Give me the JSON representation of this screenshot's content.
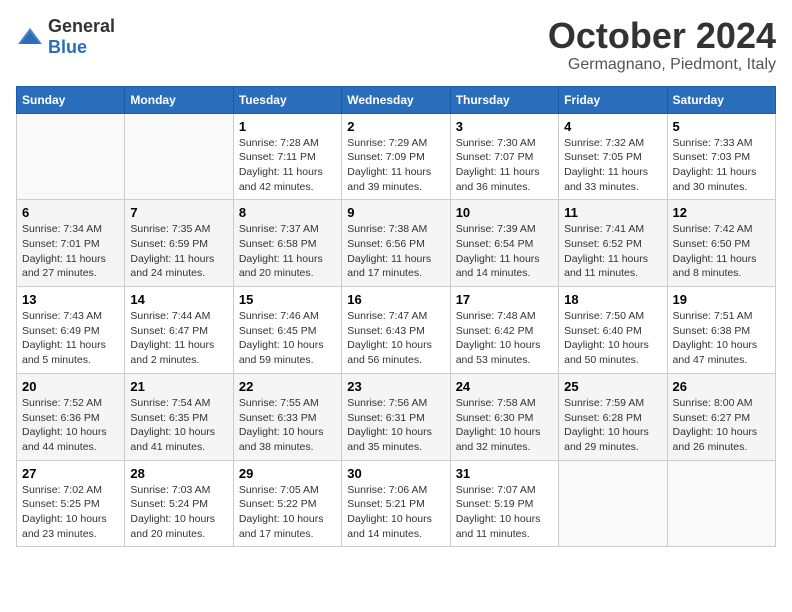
{
  "logo": {
    "general": "General",
    "blue": "Blue"
  },
  "title": "October 2024",
  "location": "Germagnano, Piedmont, Italy",
  "days_of_week": [
    "Sunday",
    "Monday",
    "Tuesday",
    "Wednesday",
    "Thursday",
    "Friday",
    "Saturday"
  ],
  "weeks": [
    [
      {
        "day": "",
        "info": ""
      },
      {
        "day": "",
        "info": ""
      },
      {
        "day": "1",
        "info": "Sunrise: 7:28 AM\nSunset: 7:11 PM\nDaylight: 11 hours and 42 minutes."
      },
      {
        "day": "2",
        "info": "Sunrise: 7:29 AM\nSunset: 7:09 PM\nDaylight: 11 hours and 39 minutes."
      },
      {
        "day": "3",
        "info": "Sunrise: 7:30 AM\nSunset: 7:07 PM\nDaylight: 11 hours and 36 minutes."
      },
      {
        "day": "4",
        "info": "Sunrise: 7:32 AM\nSunset: 7:05 PM\nDaylight: 11 hours and 33 minutes."
      },
      {
        "day": "5",
        "info": "Sunrise: 7:33 AM\nSunset: 7:03 PM\nDaylight: 11 hours and 30 minutes."
      }
    ],
    [
      {
        "day": "6",
        "info": "Sunrise: 7:34 AM\nSunset: 7:01 PM\nDaylight: 11 hours and 27 minutes."
      },
      {
        "day": "7",
        "info": "Sunrise: 7:35 AM\nSunset: 6:59 PM\nDaylight: 11 hours and 24 minutes."
      },
      {
        "day": "8",
        "info": "Sunrise: 7:37 AM\nSunset: 6:58 PM\nDaylight: 11 hours and 20 minutes."
      },
      {
        "day": "9",
        "info": "Sunrise: 7:38 AM\nSunset: 6:56 PM\nDaylight: 11 hours and 17 minutes."
      },
      {
        "day": "10",
        "info": "Sunrise: 7:39 AM\nSunset: 6:54 PM\nDaylight: 11 hours and 14 minutes."
      },
      {
        "day": "11",
        "info": "Sunrise: 7:41 AM\nSunset: 6:52 PM\nDaylight: 11 hours and 11 minutes."
      },
      {
        "day": "12",
        "info": "Sunrise: 7:42 AM\nSunset: 6:50 PM\nDaylight: 11 hours and 8 minutes."
      }
    ],
    [
      {
        "day": "13",
        "info": "Sunrise: 7:43 AM\nSunset: 6:49 PM\nDaylight: 11 hours and 5 minutes."
      },
      {
        "day": "14",
        "info": "Sunrise: 7:44 AM\nSunset: 6:47 PM\nDaylight: 11 hours and 2 minutes."
      },
      {
        "day": "15",
        "info": "Sunrise: 7:46 AM\nSunset: 6:45 PM\nDaylight: 10 hours and 59 minutes."
      },
      {
        "day": "16",
        "info": "Sunrise: 7:47 AM\nSunset: 6:43 PM\nDaylight: 10 hours and 56 minutes."
      },
      {
        "day": "17",
        "info": "Sunrise: 7:48 AM\nSunset: 6:42 PM\nDaylight: 10 hours and 53 minutes."
      },
      {
        "day": "18",
        "info": "Sunrise: 7:50 AM\nSunset: 6:40 PM\nDaylight: 10 hours and 50 minutes."
      },
      {
        "day": "19",
        "info": "Sunrise: 7:51 AM\nSunset: 6:38 PM\nDaylight: 10 hours and 47 minutes."
      }
    ],
    [
      {
        "day": "20",
        "info": "Sunrise: 7:52 AM\nSunset: 6:36 PM\nDaylight: 10 hours and 44 minutes."
      },
      {
        "day": "21",
        "info": "Sunrise: 7:54 AM\nSunset: 6:35 PM\nDaylight: 10 hours and 41 minutes."
      },
      {
        "day": "22",
        "info": "Sunrise: 7:55 AM\nSunset: 6:33 PM\nDaylight: 10 hours and 38 minutes."
      },
      {
        "day": "23",
        "info": "Sunrise: 7:56 AM\nSunset: 6:31 PM\nDaylight: 10 hours and 35 minutes."
      },
      {
        "day": "24",
        "info": "Sunrise: 7:58 AM\nSunset: 6:30 PM\nDaylight: 10 hours and 32 minutes."
      },
      {
        "day": "25",
        "info": "Sunrise: 7:59 AM\nSunset: 6:28 PM\nDaylight: 10 hours and 29 minutes."
      },
      {
        "day": "26",
        "info": "Sunrise: 8:00 AM\nSunset: 6:27 PM\nDaylight: 10 hours and 26 minutes."
      }
    ],
    [
      {
        "day": "27",
        "info": "Sunrise: 7:02 AM\nSunset: 5:25 PM\nDaylight: 10 hours and 23 minutes."
      },
      {
        "day": "28",
        "info": "Sunrise: 7:03 AM\nSunset: 5:24 PM\nDaylight: 10 hours and 20 minutes."
      },
      {
        "day": "29",
        "info": "Sunrise: 7:05 AM\nSunset: 5:22 PM\nDaylight: 10 hours and 17 minutes."
      },
      {
        "day": "30",
        "info": "Sunrise: 7:06 AM\nSunset: 5:21 PM\nDaylight: 10 hours and 14 minutes."
      },
      {
        "day": "31",
        "info": "Sunrise: 7:07 AM\nSunset: 5:19 PM\nDaylight: 10 hours and 11 minutes."
      },
      {
        "day": "",
        "info": ""
      },
      {
        "day": "",
        "info": ""
      }
    ]
  ]
}
